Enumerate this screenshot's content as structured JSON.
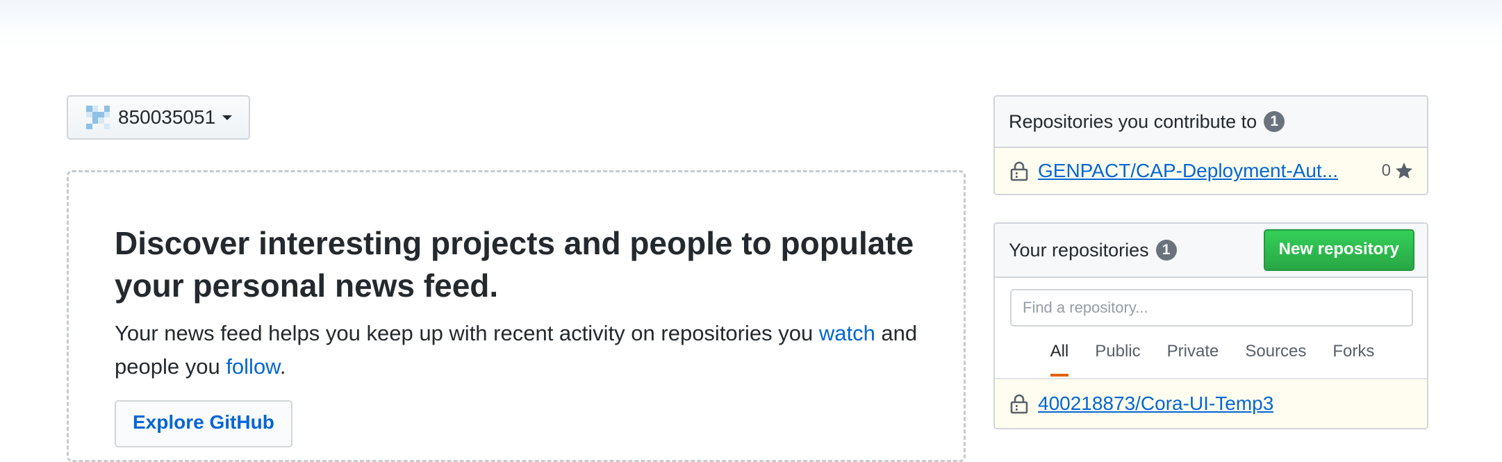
{
  "context": {
    "username": "850035051"
  },
  "discover": {
    "heading": "Discover interesting projects and people to populate your personal news feed.",
    "text_before_watch": "Your news feed helps you keep up with recent activity on repositories you ",
    "watch_link": "watch",
    "text_between": " and people you ",
    "follow_link": "follow",
    "text_after": ".",
    "explore_button": "Explore GitHub"
  },
  "contribute": {
    "title": "Repositories you contribute to",
    "count": "1",
    "repos": [
      {
        "name": "GENPACT/CAP-Deployment-Aut...",
        "stars": "0",
        "private": true
      }
    ]
  },
  "your_repos": {
    "title": "Your repositories",
    "count": "1",
    "new_button": "New repository",
    "search_placeholder": "Find a repository...",
    "filters": [
      {
        "label": "All",
        "active": true
      },
      {
        "label": "Public",
        "active": false
      },
      {
        "label": "Private",
        "active": false
      },
      {
        "label": "Sources",
        "active": false
      },
      {
        "label": "Forks",
        "active": false
      }
    ],
    "repos": [
      {
        "name": "400218873/Cora-UI-Temp3",
        "private": true
      }
    ]
  },
  "colors": {
    "link": "#0366d6",
    "new_button": "#28a745",
    "active_tab_underline": "#e36209",
    "highlight_row": "#fffdef"
  }
}
